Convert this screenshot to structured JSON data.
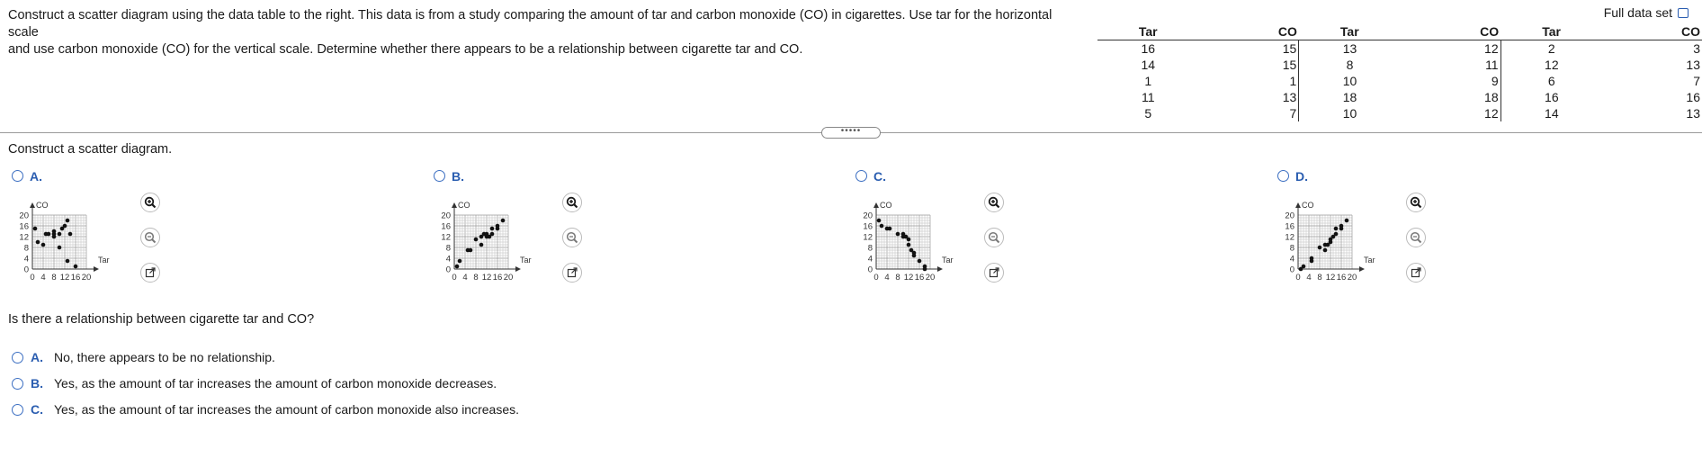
{
  "problem": {
    "line1": "Construct a scatter diagram using the data table to the right. This data is from a study comparing the amount of tar and carbon monoxide (CO) in cigarettes. Use tar for the horizontal scale",
    "line2": "and use carbon monoxide (CO) for the vertical scale. Determine whether there appears to be a relationship between cigarette tar and CO."
  },
  "full_data_set_label": "Full data set",
  "table": {
    "headers": [
      "Tar",
      "CO",
      "Tar",
      "CO",
      "Tar",
      "CO"
    ],
    "rows": [
      [
        "16",
        "15",
        "13",
        "12",
        "2",
        "3"
      ],
      [
        "14",
        "15",
        "8",
        "11",
        "12",
        "13"
      ],
      [
        "1",
        "1",
        "10",
        "9",
        "6",
        "7"
      ],
      [
        "11",
        "13",
        "18",
        "18",
        "16",
        "16"
      ],
      [
        "5",
        "7",
        "10",
        "12",
        "14",
        "13"
      ]
    ]
  },
  "divider_handle": "•••••",
  "instruction": "Construct a scatter diagram.",
  "scatter_options": [
    {
      "letter": "A.",
      "points": [
        [
          1,
          15
        ],
        [
          2,
          10
        ],
        [
          4,
          9
        ],
        [
          5,
          13
        ],
        [
          6,
          13
        ],
        [
          8,
          14
        ],
        [
          8,
          12
        ],
        [
          8,
          13
        ],
        [
          10,
          8
        ],
        [
          10,
          13
        ],
        [
          11,
          15
        ],
        [
          12,
          16
        ],
        [
          13,
          18
        ],
        [
          13,
          3
        ],
        [
          14,
          13
        ],
        [
          16,
          1
        ]
      ]
    },
    {
      "letter": "B.",
      "points": [
        [
          1,
          1
        ],
        [
          2,
          3
        ],
        [
          5,
          7
        ],
        [
          6,
          7
        ],
        [
          8,
          11
        ],
        [
          10,
          9
        ],
        [
          10,
          12
        ],
        [
          11,
          13
        ],
        [
          12,
          12
        ],
        [
          12,
          13
        ],
        [
          13,
          12
        ],
        [
          14,
          13
        ],
        [
          14,
          15
        ],
        [
          16,
          15
        ],
        [
          16,
          16
        ],
        [
          18,
          18
        ]
      ]
    },
    {
      "letter": "C.",
      "points": [
        [
          1,
          18
        ],
        [
          2,
          16
        ],
        [
          4,
          15
        ],
        [
          5,
          15
        ],
        [
          8,
          13
        ],
        [
          10,
          13
        ],
        [
          10,
          12
        ],
        [
          11,
          12
        ],
        [
          12,
          11
        ],
        [
          12,
          9
        ],
        [
          13,
          7
        ],
        [
          14,
          6
        ],
        [
          14,
          5
        ],
        [
          16,
          3
        ],
        [
          18,
          1
        ],
        [
          18,
          0
        ]
      ]
    },
    {
      "letter": "D.",
      "points": [
        [
          1,
          0
        ],
        [
          2,
          1
        ],
        [
          5,
          3
        ],
        [
          5,
          4
        ],
        [
          8,
          8
        ],
        [
          10,
          7
        ],
        [
          10,
          9
        ],
        [
          11,
          9
        ],
        [
          12,
          10
        ],
        [
          12,
          11
        ],
        [
          13,
          12
        ],
        [
          14,
          13
        ],
        [
          14,
          15
        ],
        [
          16,
          15
        ],
        [
          16,
          16
        ],
        [
          18,
          18
        ]
      ]
    }
  ],
  "axes": {
    "xlabel": "Tar",
    "ylabel": "CO",
    "xticks": [
      "0",
      "4",
      "8",
      "12",
      "16",
      "20"
    ],
    "yticks": [
      "20",
      "16",
      "12",
      "8",
      "4",
      "0"
    ],
    "xlim": [
      0,
      20
    ],
    "ylim": [
      0,
      20
    ]
  },
  "icons": [
    "zoom-in-icon",
    "zoom-out-icon",
    "open-external-icon"
  ],
  "question": "Is there a relationship between cigarette tar and CO?",
  "answers": [
    {
      "letter": "A.",
      "text": "No, there appears to be no relationship."
    },
    {
      "letter": "B.",
      "text": "Yes, as the amount of tar increases the amount of carbon monoxide decreases."
    },
    {
      "letter": "C.",
      "text": "Yes, as the amount of tar increases the amount of carbon monoxide also increases."
    }
  ],
  "colors": {
    "accent": "#2a5db0",
    "radio_border": "#3c6fc2"
  }
}
